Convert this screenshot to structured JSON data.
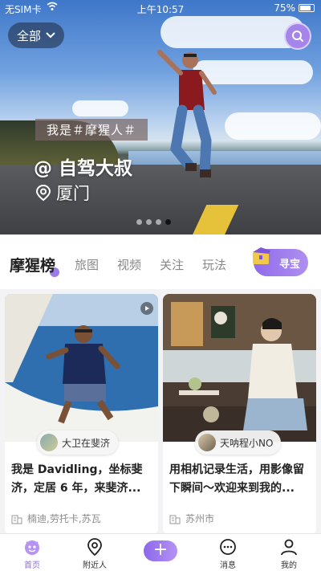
{
  "status_bar": {
    "carrier": "无SIM卡",
    "time": "上午10:57",
    "battery": "75%"
  },
  "hero": {
    "filter_label": "全部",
    "tag_line": "我是＃摩猩人＃",
    "name": "@ 自驾大叔",
    "location": "厦门",
    "dots_total": 4,
    "dots_active": 4
  },
  "tabs": {
    "main": "摩猩榜",
    "items": [
      "旅图",
      "视频",
      "关注",
      "玩法"
    ],
    "treasure": "寻宝"
  },
  "cards": [
    {
      "author": "大卫在斐济",
      "title": "我是 Davidling，坐标斐济，定居 6 年，来斐济...",
      "meta": "楠迪,劳托卡,苏瓦",
      "is_video": true
    },
    {
      "author": "天呐程小NO",
      "title": "用相机记录生活，用影像留下瞬间～欢迎来到我的...",
      "meta": "苏州市",
      "is_video": false
    }
  ],
  "bottom_nav": {
    "items": [
      {
        "label": "首页",
        "icon": "home-icon",
        "active": true
      },
      {
        "label": "附近人",
        "icon": "location-pin-icon",
        "active": false
      },
      {
        "label": "消息",
        "icon": "chat-bubble-icon",
        "active": false
      },
      {
        "label": "我的",
        "icon": "profile-icon",
        "active": false
      }
    ],
    "add_label": "+"
  },
  "colors": {
    "accent": "#8e6ce8",
    "accent_light": "#b493f2"
  }
}
